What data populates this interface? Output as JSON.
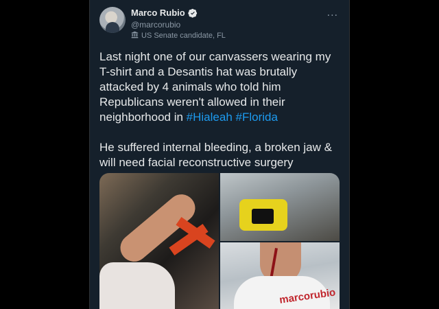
{
  "tweet": {
    "display_name": "Marco Rubio",
    "handle": "@marcorubio",
    "label": "US Senate candidate, FL",
    "more_icon": "...",
    "text": {
      "para1_before": "Last night one of our canvassers wearing my T-shirt and a Desantis hat was brutally attacked by 4 animals who told him Republicans weren't allowed in their neighborhood in ",
      "hashtag1": "#Hialeah",
      "space": " ",
      "hashtag2": "#Florida",
      "para2": "He suffered internal bleeding, a broken jaw & will need facial reconstructive surgery"
    },
    "photos": {
      "shirt_text": "marcorubio"
    }
  },
  "colors": {
    "background": "#15202b",
    "text": "#e7e9ea",
    "secondary": "#8b98a5",
    "link": "#1d9bf0",
    "verified": "#1d9bf0"
  }
}
